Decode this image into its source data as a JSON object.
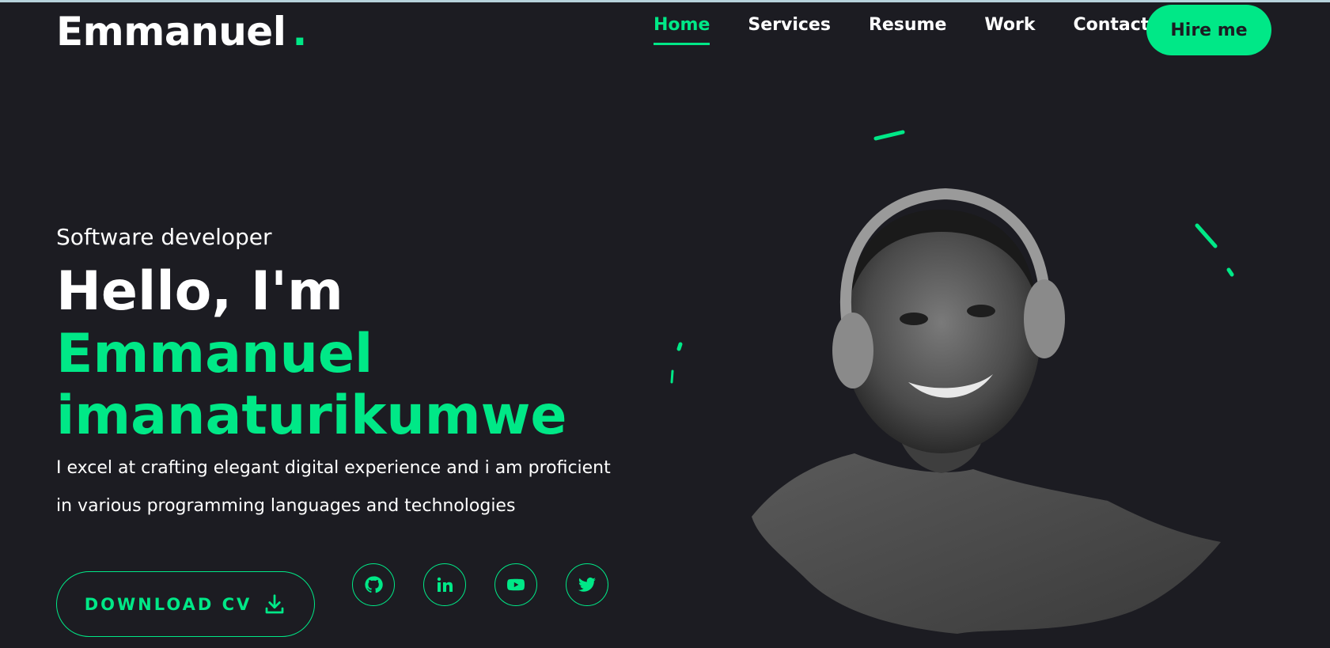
{
  "header": {
    "logo_text": "Emmanuel",
    "logo_dot": ".",
    "nav": [
      {
        "label": "Home",
        "active": true
      },
      {
        "label": "Services",
        "active": false
      },
      {
        "label": "Resume",
        "active": false
      },
      {
        "label": "Work",
        "active": false
      },
      {
        "label": "Contact",
        "active": false
      }
    ],
    "hire_label": "Hire me"
  },
  "hero": {
    "subtitle": "Software developer",
    "greeting": "Hello, I'm",
    "name": "Emmanuel imanaturikumwe",
    "description": "I excel at crafting elegant digital experience and i am proficient in various programming languages and technologies",
    "download_label": "DOWNLOAD CV",
    "download_icon": "download-icon",
    "socials": [
      {
        "name": "github",
        "icon": "github-icon"
      },
      {
        "name": "linkedin",
        "icon": "linkedin-icon"
      },
      {
        "name": "youtube",
        "icon": "youtube-icon"
      },
      {
        "name": "twitter",
        "icon": "twitter-icon"
      }
    ]
  },
  "colors": {
    "background": "#1c1c22",
    "accent": "#00e887",
    "text": "#ffffff"
  }
}
